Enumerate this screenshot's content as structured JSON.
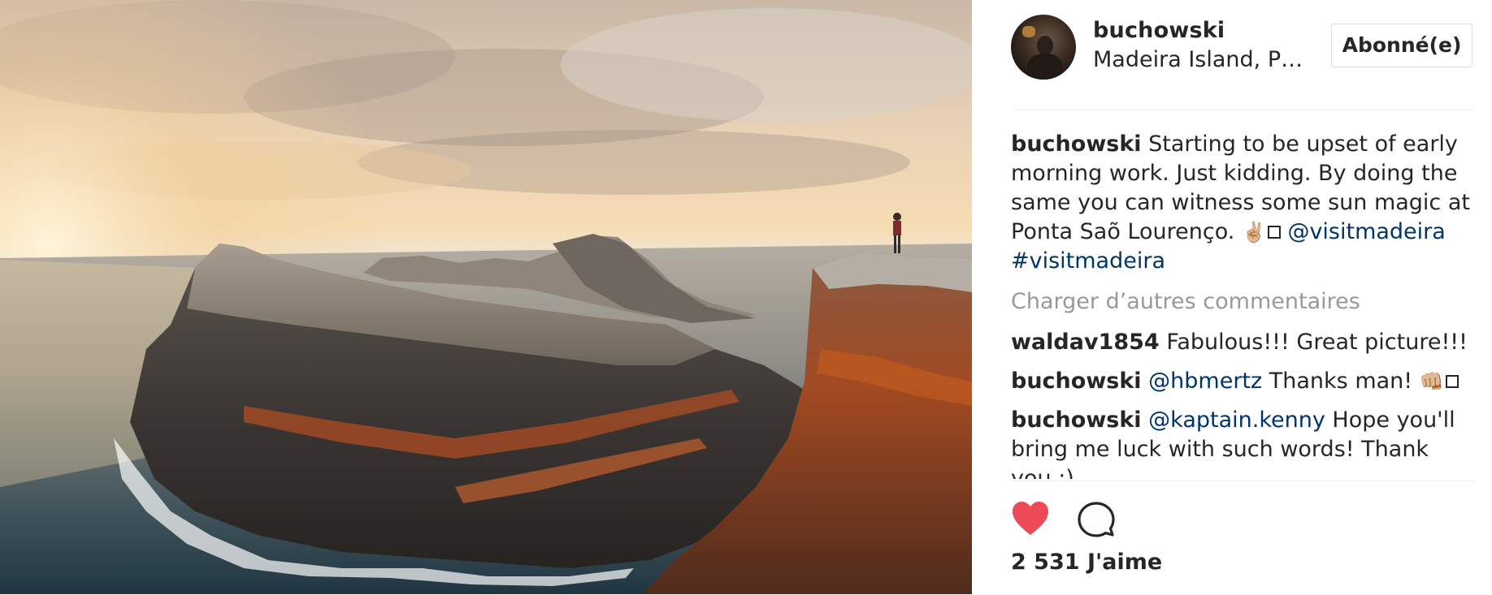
{
  "post": {
    "image_alt": "",
    "author": {
      "username": "buchowski",
      "location": "Madeira Island, P…"
    },
    "follow_button_label": "Abonné(e)",
    "caption": {
      "username": "buchowski",
      "text": "Starting to be upset of early morning work. Just kidding. By doing the same you can witness some sun magic at Ponta Saõ Lourenço.",
      "emoji": "✌🏼",
      "mention": "@visitmadeira",
      "hashtag": "#visitmadeira"
    },
    "load_more_label": "Charger d’autres commentaires",
    "comments": [
      {
        "username": "waldav1854",
        "mention": "",
        "text": "Fabulous!!! Great picture!!!"
      },
      {
        "username": "buchowski",
        "mention": "@hbmertz",
        "text": "Thanks man!",
        "emoji": "👊🏼"
      },
      {
        "username": "buchowski",
        "mention": "@kaptain.kenny",
        "text": "Hope you'll bring me luck with such words! Thank you :)"
      }
    ],
    "likes_label": "2 531 J'aime",
    "colors": {
      "like_heart": "#ed4956",
      "mention_link": "#003569",
      "muted_text": "#999999",
      "divider": "#efefef"
    },
    "icons": {
      "like": "heart-filled-icon",
      "comment": "speech-bubble-icon"
    }
  }
}
